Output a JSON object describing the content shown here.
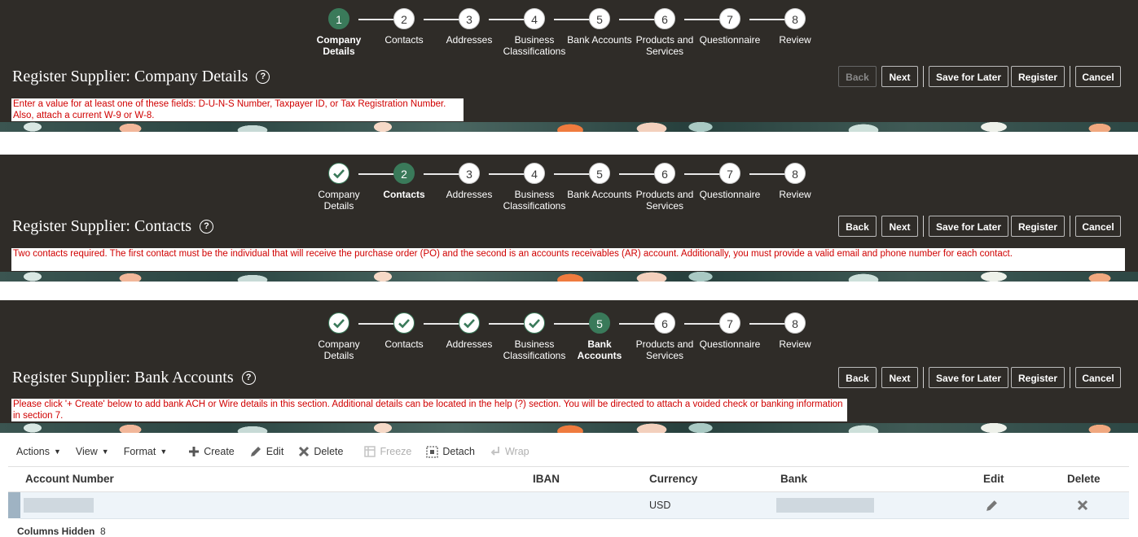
{
  "sections": [
    {
      "title": "Register Supplier: Company Details",
      "message": "Enter a value for at least one of these fields: D-U-N-S Number, Taxpayer ID, or Tax Registration Number. Also, attach a current W-9 or W-8.",
      "current_step": 1
    },
    {
      "title": "Register Supplier: Contacts",
      "message": "Two contacts required. The first contact must be the individual that will receive the purchase order (PO) and the second is an accounts receivables (AR) account. Additionally, you must provide a valid email and phone number for each contact.",
      "current_step": 2
    },
    {
      "title": "Register Supplier: Bank Accounts",
      "message": "Please click '+ Create' below to add bank ACH or Wire details in this section. Additional details can be located in the help (?) section. You will be directed to attach a voided check or banking information in section 7.",
      "current_step": 5
    }
  ],
  "steps": [
    {
      "number": "1",
      "label": "Company Details"
    },
    {
      "number": "2",
      "label": "Contacts"
    },
    {
      "number": "3",
      "label": "Addresses"
    },
    {
      "number": "4",
      "label": "Business Classifications"
    },
    {
      "number": "5",
      "label": "Bank Accounts"
    },
    {
      "number": "6",
      "label": "Products and Services"
    },
    {
      "number": "7",
      "label": "Questionnaire"
    },
    {
      "number": "8",
      "label": "Review"
    }
  ],
  "step_labels_wrapped": {
    "company": [
      "Company",
      "Details"
    ],
    "business": [
      "Business",
      "Classifications"
    ],
    "products": [
      "Products and",
      "Services"
    ],
    "bank": [
      "Bank",
      "Accounts"
    ]
  },
  "buttons": {
    "back": "Back",
    "next": "Next",
    "save_for_later": "Save for Later",
    "register": "Register",
    "cancel": "Cancel"
  },
  "toolbar": {
    "actions": "Actions",
    "view": "View",
    "format": "Format",
    "create": "Create",
    "edit": "Edit",
    "delete": "Delete",
    "freeze": "Freeze",
    "detach": "Detach",
    "wrap": "Wrap"
  },
  "table": {
    "columns": [
      "Account Number",
      "IBAN",
      "Currency",
      "Bank",
      "Edit",
      "Delete"
    ],
    "rows": [
      {
        "account_number": "",
        "iban": "",
        "currency": "USD",
        "bank": ""
      }
    ]
  },
  "footer": {
    "columns_hidden_label": "Columns Hidden",
    "columns_hidden_count": "8"
  },
  "colors": {
    "header_bg": "#2f2c28",
    "current_step": "#3a7a5a",
    "message_text": "#d00000",
    "row_highlight": "#eef4f9"
  }
}
